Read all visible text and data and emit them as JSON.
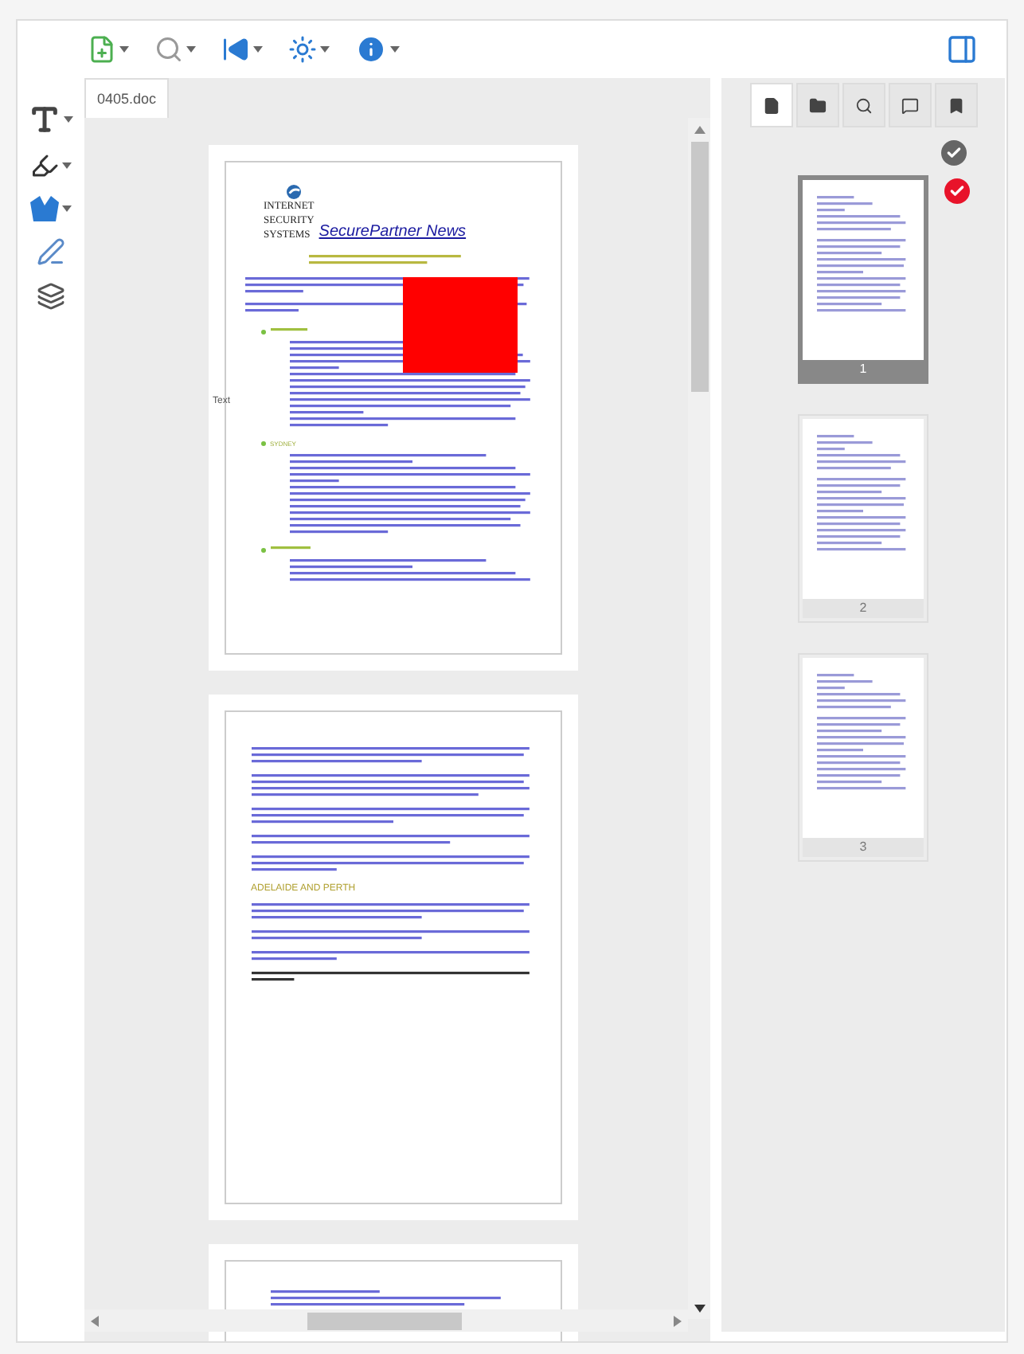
{
  "document_tab": {
    "label": "0405.doc",
    "selected": true
  },
  "page_1": {
    "logo_lines": [
      "INTERNET",
      "SECURITY",
      "SYSTEMS"
    ],
    "title": "SecurePartner News",
    "margin_note": "Text",
    "section_heading": "SYDNEY"
  },
  "page_2": {
    "section_heading": "ADELAIDE AND PERTH"
  },
  "side_tabs": [
    {
      "kind": "page",
      "selected": true
    },
    {
      "kind": "folder",
      "selected": false
    },
    {
      "kind": "search",
      "selected": false
    },
    {
      "kind": "comment",
      "selected": false
    },
    {
      "kind": "bookmark",
      "selected": false
    }
  ],
  "thumbnails": [
    {
      "label": "1",
      "selected": true,
      "checked": true
    },
    {
      "label": "2",
      "selected": false,
      "checked": false
    },
    {
      "label": "3",
      "selected": false,
      "checked": false
    }
  ]
}
